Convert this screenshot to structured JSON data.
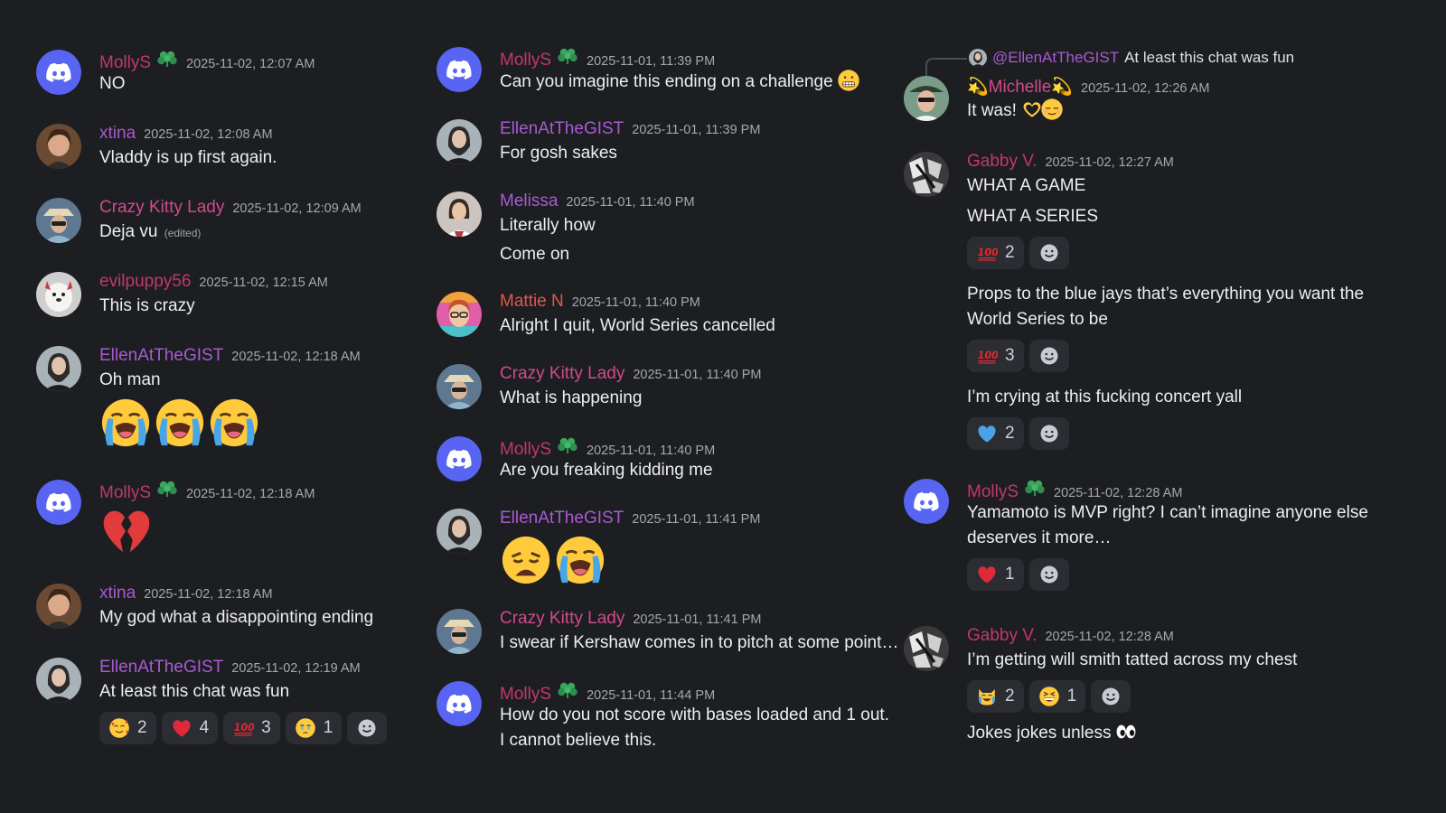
{
  "colors": {
    "background": "#1d1e22",
    "molly": "#c2386a",
    "purple": "#a95ad2",
    "pink": "#d04b8c",
    "red": "#e4564b",
    "discord_blue": "#5865f2",
    "timestamp": "#a4a7ae",
    "reaction_bg": "#2b2d33"
  },
  "col1": [
    {
      "user": "MollyS",
      "badge": true,
      "time": "2025-11-02, 12:07 AM",
      "lines": [
        "NO"
      ]
    },
    {
      "user": "xtina",
      "time": "2025-11-02, 12:08 AM",
      "lines": [
        "Vladdy is up first again."
      ]
    },
    {
      "user": "Crazy Kitty Lady",
      "time": "2025-11-02, 12:09 AM",
      "lines": [
        "Deja vu"
      ],
      "edited": "(edited)"
    },
    {
      "user": "evilpuppy56",
      "time": "2025-11-02, 12:15 AM",
      "lines": [
        "This is crazy"
      ]
    },
    {
      "user": "EllenAtTheGIST",
      "time": "2025-11-02, 12:18 AM",
      "lines": [
        "Oh man"
      ],
      "emojis": [
        "loudly-crying-face",
        "loudly-crying-face",
        "loudly-crying-face"
      ]
    },
    {
      "user": "MollyS",
      "badge": true,
      "time": "2025-11-02, 12:18 AM",
      "emojis": [
        "broken-heart"
      ]
    },
    {
      "user": "xtina",
      "time": "2025-11-02, 12:18 AM",
      "lines": [
        "My god what a disappointing ending"
      ]
    },
    {
      "user": "EllenAtTheGIST",
      "time": "2025-11-02, 12:19 AM",
      "lines": [
        "At least this chat was fun"
      ],
      "reactions": [
        {
          "emoji": "smiling-face-with-hearts",
          "count": "2"
        },
        {
          "emoji": "red-heart",
          "count": "4"
        },
        {
          "emoji": "hundred-points",
          "count": "3"
        },
        {
          "emoji": "face-holding-back-tears",
          "count": "1"
        }
      ]
    }
  ],
  "col2": [
    {
      "user": "MollyS",
      "badge": true,
      "time": "2025-11-01, 11:39 PM",
      "lines": [
        "Can you imagine this ending on a challenge"
      ],
      "inline_emoji": "grimacing-face"
    },
    {
      "user": "EllenAtTheGIST",
      "time": "2025-11-01, 11:39 PM",
      "lines": [
        "For gosh sakes"
      ]
    },
    {
      "user": "Melissa",
      "time": "2025-11-01, 11:40 PM",
      "lines": [
        "Literally how",
        "Come on"
      ]
    },
    {
      "user": "Mattie N",
      "time": "2025-11-01, 11:40 PM",
      "lines": [
        "Alright I quit, World Series cancelled"
      ]
    },
    {
      "user": "Crazy Kitty Lady",
      "time": "2025-11-01, 11:40 PM",
      "lines": [
        "What is happening"
      ]
    },
    {
      "user": "MollyS",
      "badge": true,
      "time": "2025-11-01, 11:40 PM",
      "lines": [
        "Are you freaking kidding me"
      ]
    },
    {
      "user": "EllenAtTheGIST",
      "time": "2025-11-01, 11:41 PM",
      "emojis": [
        "weary-face",
        "loudly-crying-face"
      ]
    },
    {
      "user": "Crazy Kitty Lady",
      "time": "2025-11-01, 11:41 PM",
      "lines": [
        "I swear if Kershaw comes in to pitch at some point…"
      ]
    },
    {
      "user": "MollyS",
      "badge": true,
      "time": "2025-11-01, 11:44 PM",
      "lines": [
        "How do you not score with bases loaded and 1 out. I cannot believe this."
      ]
    }
  ],
  "col3": [
    {
      "reply_to": "@EllenAtTheGIST",
      "reply_text": "At least this chat was fun",
      "user": "💫Michelle💫",
      "time": "2025-11-02, 12:26 AM",
      "lines": [
        "It was!"
      ],
      "inline_emojis": [
        "heart-hands",
        "relieved-face"
      ]
    },
    {
      "user": "Gabby V.",
      "time": "2025-11-02, 12:27 AM",
      "lines": [
        "WHAT A GAME",
        "WHAT A SERIES"
      ],
      "reactions": [
        {
          "emoji": "hundred-points",
          "count": "2"
        }
      ],
      "followups": [
        {
          "text": "Props to the blue jays that’s everything you want the World Series to be",
          "reactions": [
            {
              "emoji": "hundred-points",
              "count": "3"
            }
          ]
        },
        {
          "text": "I’m crying at this fucking concert yall",
          "reactions": [
            {
              "emoji": "blue-heart",
              "count": "2"
            }
          ]
        }
      ]
    },
    {
      "user": "MollyS",
      "badge": true,
      "time": "2025-11-02, 12:28 AM",
      "lines": [
        "Yamamoto is MVP right? I can’t imagine anyone else deserves it more…"
      ],
      "reactions": [
        {
          "emoji": "red-heart",
          "count": "1"
        }
      ]
    },
    {
      "user": "Gabby V.",
      "time": "2025-11-02, 12:28 AM",
      "lines": [
        "I’m getting will smith tatted across my chest"
      ],
      "reactions": [
        {
          "emoji": "cat-with-tears-of-joy",
          "count": "2"
        },
        {
          "emoji": "grinning-squinting-face",
          "count": "1"
        }
      ],
      "followups": [
        {
          "text": "Jokes jokes unless",
          "inline_emoji": "eyes"
        }
      ]
    }
  ]
}
